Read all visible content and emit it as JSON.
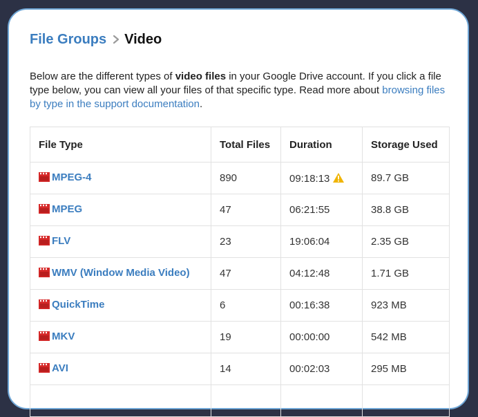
{
  "breadcrumb": {
    "parent": "File Groups",
    "current": "Video"
  },
  "intro": {
    "part1": "Below are the different types of ",
    "bold": "video files",
    "part2": " in your Google Drive account. If you click a file type below, you can view all your files of that specific type. Read more about ",
    "link": "browsing files by type in the support documentation",
    "part3": "."
  },
  "table": {
    "headers": [
      "File Type",
      "Total Files",
      "Duration",
      "Storage Used"
    ],
    "rows": [
      {
        "type": "MPEG-4",
        "total": "890",
        "duration": "09:18:13",
        "storage": "89.7 GB",
        "warning": true
      },
      {
        "type": "MPEG",
        "total": "47",
        "duration": "06:21:55",
        "storage": "38.8 GB",
        "warning": false
      },
      {
        "type": "FLV",
        "total": "23",
        "duration": "19:06:04",
        "storage": "2.35 GB",
        "warning": false
      },
      {
        "type": "WMV (Window Media Video)",
        "total": "47",
        "duration": "04:12:48",
        "storage": "1.71 GB",
        "warning": false
      },
      {
        "type": "QuickTime",
        "total": "6",
        "duration": "00:16:38",
        "storage": "923 MB",
        "warning": false
      },
      {
        "type": "MKV",
        "total": "19",
        "duration": "00:00:00",
        "storage": "542 MB",
        "warning": false
      },
      {
        "type": "AVI",
        "total": "14",
        "duration": "00:02:03",
        "storage": "295 MB",
        "warning": false
      }
    ]
  },
  "icons": {
    "file_type": "film-clapper-icon",
    "warning": "warning-triangle-icon",
    "separator": "chevron-right-icon"
  },
  "colors": {
    "background": "#2c3145",
    "card_border": "#6fa6d6",
    "link": "#3b7dbf",
    "film_icon": "#d62828",
    "warning": "#f0b400"
  }
}
